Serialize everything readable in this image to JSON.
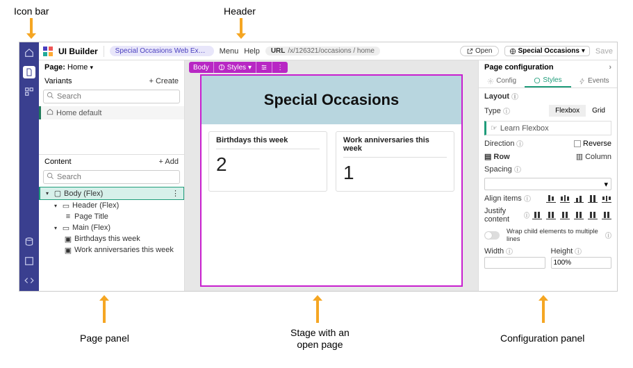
{
  "annotations": {
    "iconbar": "Icon bar",
    "header": "Header",
    "pagepanel": "Page panel",
    "stage": "Stage with an\nopen page",
    "config": "Configuration panel"
  },
  "header": {
    "appTitle": "UI Builder",
    "pill": "Special Occasions Web Experie…",
    "menu": "Menu",
    "help": "Help",
    "urlLabel": "URL",
    "urlPath": "/x/126321/occasions / home",
    "open": "Open",
    "env": "Special Occasions",
    "save": "Save"
  },
  "left": {
    "pageLabel": "Page:",
    "pageName": "Home",
    "variantsLabel": "Variants",
    "createLabel": "+ Create",
    "searchPlaceholder": "Search",
    "variantItem": "Home default",
    "contentLabel": "Content",
    "addLabel": "+ Add",
    "tree": {
      "body": "Body (Flex)",
      "header": "Header (Flex)",
      "pageTitle": "Page Title",
      "main": "Main (Flex)",
      "card1": "Birthdays this week",
      "card2": "Work anniversaries this week"
    }
  },
  "toolbar": {
    "body": "Body",
    "styles": "Styles"
  },
  "stage": {
    "title": "Special Occasions",
    "card1Title": "Birthdays this week",
    "card1Value": "2",
    "card2Title": "Work anniversaries this week",
    "card2Value": "1"
  },
  "right": {
    "title": "Page configuration",
    "tabConfig": "Config",
    "tabStyles": "Styles",
    "tabEvents": "Events",
    "layout": "Layout",
    "type": "Type",
    "flexbox": "Flexbox",
    "grid": "Grid",
    "learn": "Learn Flexbox",
    "direction": "Direction",
    "row": "Row",
    "column": "Column",
    "reverse": "Reverse",
    "spacing": "Spacing",
    "alignItems": "Align items",
    "justify": "Justify content",
    "wrap": "Wrap child elements to multiple lines",
    "width": "Width",
    "height": "Height",
    "heightValue": "100%"
  }
}
